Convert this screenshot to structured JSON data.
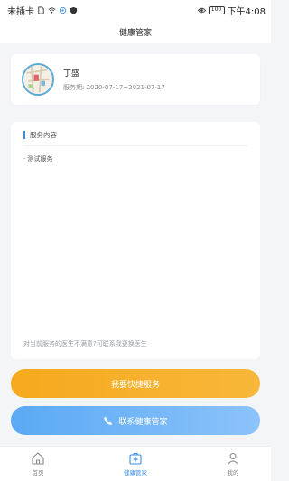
{
  "status_bar": {
    "carrier": "未插卡",
    "battery": "100",
    "time": "下午4:08"
  },
  "header": {
    "title": "健康管家"
  },
  "profile": {
    "name": "丁盛",
    "period_label": "服务期:",
    "period": "2020-07-17~2021-07-17"
  },
  "service": {
    "title": "服务内容",
    "items": [
      "· 测试服务"
    ],
    "note": "对当前服务的医生不满意?可联系我更换医生"
  },
  "buttons": {
    "quick_service": "我要快捷服务",
    "contact_manager": "联系健康管家"
  },
  "tabs": [
    {
      "label": "首页",
      "icon": "home-icon",
      "active": false
    },
    {
      "label": "健康管家",
      "icon": "medical-kit-icon",
      "active": true
    },
    {
      "label": "我的",
      "icon": "user-icon",
      "active": false
    }
  ],
  "colors": {
    "accent_blue": "#3a8fe0",
    "button_orange": "#f6a91c",
    "button_blue": "#5aa9f4",
    "background": "#f4f5f7"
  }
}
